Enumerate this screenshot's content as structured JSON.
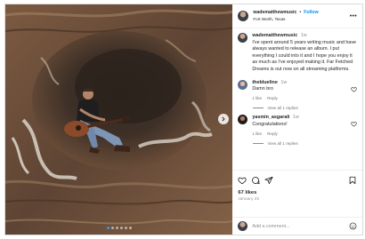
{
  "post": {
    "header": {
      "username": "wadematthewmusic",
      "separator": "•",
      "follow_label": "Follow",
      "location": "Fort Worth, Texas",
      "more_icon": "ellipsis-icon"
    },
    "carousel": {
      "total_slides": 6,
      "active_slide": 1,
      "next_icon": "chevron-right-icon"
    },
    "caption": {
      "username": "wadematthewmusic",
      "time": "1w",
      "text": "I've spent around 5 years writing music and have always wanted to release an album. I put everything I could into it and I hope you enjoy it as much as I've enjoyed making it. Far Fetched Dreams is out now on all streaming platforms."
    },
    "comments": [
      {
        "username": "theblueline",
        "time": "1w",
        "text": "Damn bro",
        "likes": "1 like",
        "reply_label": "Reply",
        "view_replies": "View all 1 replies"
      },
      {
        "username": "yasmin_asgarali",
        "time": "1w",
        "text": "Congratulations!",
        "likes": "1 like",
        "reply_label": "Reply",
        "view_replies": "View all 1 replies"
      }
    ],
    "likes": "67 likes",
    "date": "January 25",
    "add_comment": {
      "placeholder": "Add a comment...",
      "emoji_icon": "smiley-icon"
    },
    "colors": {
      "accent": "#0095f6",
      "secondary_text": "#737373",
      "border": "#dbdbdb"
    }
  }
}
